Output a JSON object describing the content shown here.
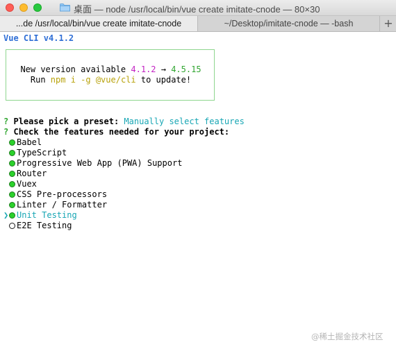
{
  "window": {
    "title": "桌面 — node /usr/local/bin/vue create imitate-cnode — 80×30"
  },
  "tabs": [
    {
      "label": "...de /usr/local/bin/vue create imitate-cnode",
      "active": true
    },
    {
      "label": "~/Desktop/imitate-cnode — -bash",
      "active": false
    }
  ],
  "terminal": {
    "header": "Vue CLI v4.1.2",
    "update_box": {
      "line1_prefix": "New version available ",
      "current_version": "4.1.2",
      "arrow": " → ",
      "new_version": "4.5.15",
      "line2_prefix": "Run ",
      "command": "npm i -g @vue/cli",
      "line2_suffix": " to update!"
    },
    "prompt_symbol": "?",
    "preset_question": "Please pick a preset:",
    "preset_answer": "Manually select features",
    "features_question": "Check the features needed for your project:",
    "features": [
      {
        "label": "Babel",
        "checked": true,
        "cursor": false
      },
      {
        "label": "TypeScript",
        "checked": true,
        "cursor": false
      },
      {
        "label": "Progressive Web App (PWA) Support",
        "checked": true,
        "cursor": false
      },
      {
        "label": "Router",
        "checked": true,
        "cursor": false
      },
      {
        "label": "Vuex",
        "checked": true,
        "cursor": false
      },
      {
        "label": "CSS Pre-processors",
        "checked": true,
        "cursor": false
      },
      {
        "label": "Linter / Formatter",
        "checked": true,
        "cursor": false
      },
      {
        "label": "Unit Testing",
        "checked": true,
        "cursor": true
      },
      {
        "label": "E2E Testing",
        "checked": false,
        "cursor": false
      }
    ],
    "cursor_symbol": "❯"
  },
  "watermark": "@稀土掘金技术社区",
  "colors": {
    "header": "#2f6fd6",
    "current_version": "#c321c3",
    "new_version": "#2fa52f",
    "command": "#b8a20b",
    "answer": "#17a6b4",
    "checked_radio": "#2bd12b"
  }
}
